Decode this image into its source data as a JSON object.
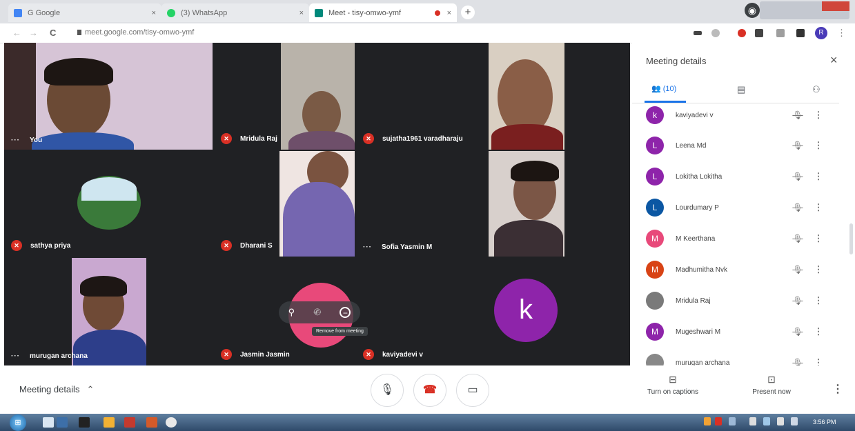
{
  "browser": {
    "tabs": [
      {
        "label": "G Google",
        "close": "×"
      },
      {
        "label": "(3) WhatsApp",
        "close": "×"
      },
      {
        "label": "Meet - tisy-omwo-ymf",
        "close": "×"
      }
    ],
    "new_tab": "+",
    "url": "meet.google.com/tisy-omwo-ymf",
    "profile_initial": "R",
    "nav": {
      "back": "←",
      "forward": "→",
      "reload": "C"
    }
  },
  "tiles": [
    {
      "name": "You",
      "state": "more"
    },
    {
      "name": "Mridula Raj",
      "state": "muted"
    },
    {
      "name": "sujatha1961 varadharaju",
      "state": "muted"
    },
    {
      "name": "sathya priya",
      "state": "muted"
    },
    {
      "name": "Dharani S",
      "state": "muted"
    },
    {
      "name": "Sofia Yasmin M",
      "state": "more"
    },
    {
      "name": "murugan archana",
      "state": "more"
    },
    {
      "name": "Jasmin Jasmin",
      "state": "muted"
    },
    {
      "name": "kaviyadevi v",
      "state": "muted"
    }
  ],
  "avatar_k": "k",
  "hover_tooltip": "Remove from meeting",
  "panel": {
    "title": "Meeting details",
    "close": "×",
    "tabs": {
      "people": "(10)"
    },
    "participants": [
      {
        "initial": "k",
        "name": "kaviyadevi v",
        "color": "#8e24aa"
      },
      {
        "initial": "L",
        "name": "Leena Md",
        "color": "#8e24aa"
      },
      {
        "initial": "L",
        "name": "Lokitha Lokitha",
        "color": "#8e24aa"
      },
      {
        "initial": "L",
        "name": "Lourdumary P",
        "color": "#0b57a3"
      },
      {
        "initial": "M",
        "name": "M Keerthana",
        "color": "#e8497a"
      },
      {
        "initial": "M",
        "name": "Madhumitha Nvk",
        "color": "#d84315"
      },
      {
        "initial": "",
        "name": "Mridula Raj",
        "color": "#7a7a7a"
      },
      {
        "initial": "M",
        "name": "Mugeshwari M",
        "color": "#8e24aa"
      },
      {
        "initial": "",
        "name": "murugan archana",
        "color": "#888888"
      }
    ]
  },
  "bottom": {
    "meeting_details": "Meeting details",
    "captions": "Turn on captions",
    "present": "Present now"
  },
  "taskbar": {
    "clock": "3:56 PM"
  }
}
